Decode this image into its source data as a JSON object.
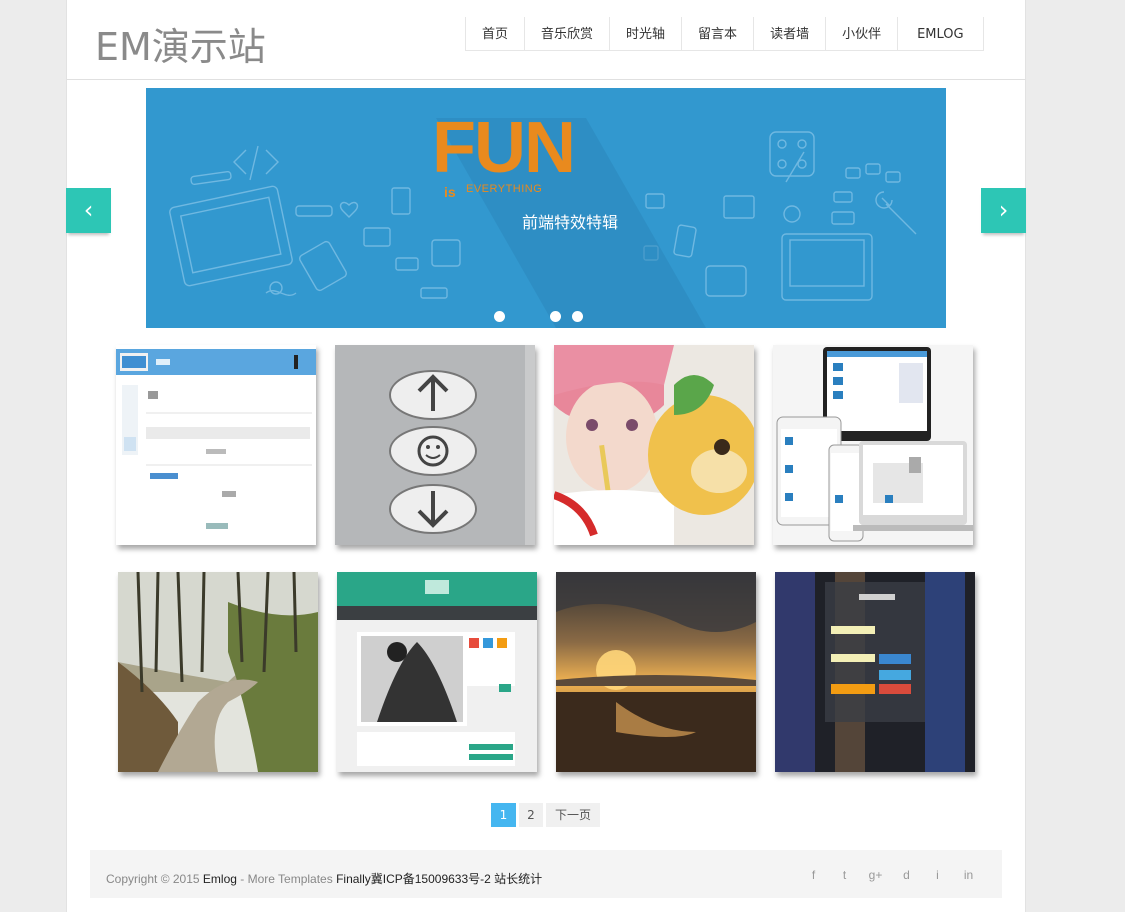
{
  "site": {
    "title": "EM演示站"
  },
  "nav": {
    "items": [
      "首页",
      "音乐欣赏",
      "时光轴",
      "留言本",
      "读者墙",
      "小伙伴",
      "EMLOG"
    ]
  },
  "banner": {
    "fun_small": "is",
    "fun_big": "FUN",
    "fun_sub": "EVERYTHING",
    "subtitle": "前端特效特辑",
    "prev_icon": "chevron-left-icon",
    "next_icon": "chevron-right-icon"
  },
  "thumbnails": [
    {
      "name": "emlog-admin-screenshot",
      "bg": "#f4f6f9"
    },
    {
      "name": "up-smile-down-buttons",
      "bg": "#b9bbbd"
    },
    {
      "name": "cosplay-girl-plush",
      "bg": "#e4dccf"
    },
    {
      "name": "responsive-devices",
      "bg": "#f3f3f3"
    },
    {
      "name": "forest-road",
      "bg": "#6f7552"
    },
    {
      "name": "blog-template-preview",
      "bg": "#f1f1f1"
    },
    {
      "name": "beach-sunset",
      "bg": "#4d3e2c"
    },
    {
      "name": "finallys-blog-login",
      "bg": "#2d3038"
    }
  ],
  "pagination": {
    "pages": [
      "1",
      "2"
    ],
    "next": "下一页",
    "active": "1"
  },
  "footer": {
    "copyright": "Copyright © 2015 ",
    "emlog": "Emlog",
    "more": " - More Templates ",
    "icp": "Finally冀ICP备15009633号-2 站长统计",
    "social": [
      "f",
      "t",
      "g+",
      "d",
      "i",
      "in"
    ],
    "social_names": [
      "facebook-icon",
      "twitter-icon",
      "google-plus-icon",
      "dribbble-icon",
      "instagram-icon",
      "linkedin-icon"
    ]
  },
  "colors": {
    "accent": "#2dc6b5",
    "banner": "#3298cf",
    "page_active": "#45b6f0",
    "fun_orange": "#e98a1e"
  }
}
